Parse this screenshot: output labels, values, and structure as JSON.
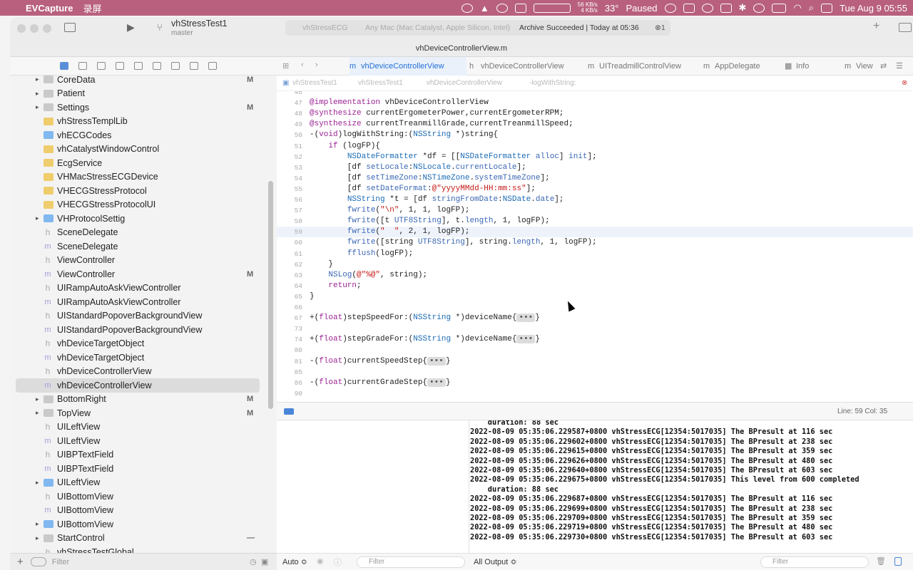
{
  "menubar": {
    "app": "EVCapture",
    "menu": "录屏",
    "net_up": "56 KB/s",
    "net_down": "4 KB/s",
    "temperature": "33°",
    "status": "Paused",
    "clock": "Tue Aug 9  05:55"
  },
  "toolbar": {
    "scheme": "vhStressTest1",
    "branch": "master",
    "target": "vhStressECG",
    "destination": "Any Mac (Mac Catalyst, Apple Silicon, Intel)",
    "activity": "Archive Succeeded | Today at 05:36",
    "error_count": "1",
    "file_title": "vhDeviceControllerView.m"
  },
  "sidebar": {
    "items": [
      {
        "label": "CoreData",
        "kind": "folder",
        "status": "M",
        "tw": "▸"
      },
      {
        "label": "Patient",
        "kind": "folder",
        "status": "",
        "tw": "▸"
      },
      {
        "label": "Settings",
        "kind": "folder",
        "status": "M",
        "tw": "▸"
      },
      {
        "label": "vhStressTemplLib",
        "kind": "yfolder",
        "status": "",
        "tw": ""
      },
      {
        "label": "vhECGCodes",
        "kind": "bfolder",
        "status": "",
        "tw": ""
      },
      {
        "label": "vhCatalystWindowControl",
        "kind": "yfolder",
        "status": "",
        "tw": ""
      },
      {
        "label": "EcgService",
        "kind": "yfolder",
        "status": "",
        "tw": ""
      },
      {
        "label": "VHMacStressECGDevice",
        "kind": "yfolder",
        "status": "",
        "tw": ""
      },
      {
        "label": "VHECGStressProtocol",
        "kind": "yfolder",
        "status": "",
        "tw": ""
      },
      {
        "label": "VHECGStressProtocolUI",
        "kind": "yfolder",
        "status": "",
        "tw": ""
      },
      {
        "label": "VHProtocolSettig",
        "kind": "bfolder",
        "status": "",
        "tw": "▸"
      },
      {
        "label": "SceneDelegate",
        "kind": "h",
        "status": "",
        "tw": ""
      },
      {
        "label": "SceneDelegate",
        "kind": "m",
        "status": "",
        "tw": ""
      },
      {
        "label": "ViewController",
        "kind": "h",
        "status": "",
        "tw": ""
      },
      {
        "label": "ViewController",
        "kind": "m",
        "status": "M",
        "tw": ""
      },
      {
        "label": "UIRampAutoAskViewController",
        "kind": "h",
        "status": "",
        "tw": ""
      },
      {
        "label": "UIRampAutoAskViewController",
        "kind": "m",
        "status": "",
        "tw": ""
      },
      {
        "label": "UIStandardPopoverBackgroundView",
        "kind": "h",
        "status": "",
        "tw": ""
      },
      {
        "label": "UIStandardPopoverBackgroundView",
        "kind": "m",
        "status": "",
        "tw": ""
      },
      {
        "label": "vhDeviceTargetObject",
        "kind": "h",
        "status": "",
        "tw": ""
      },
      {
        "label": "vhDeviceTargetObject",
        "kind": "m",
        "status": "",
        "tw": ""
      },
      {
        "label": "vhDeviceControllerView",
        "kind": "h",
        "status": "",
        "tw": ""
      },
      {
        "label": "vhDeviceControllerView",
        "kind": "m",
        "status": "",
        "tw": "",
        "selected": true
      },
      {
        "label": "BottomRight",
        "kind": "folder",
        "status": "M",
        "tw": "▸"
      },
      {
        "label": "TopView",
        "kind": "folder",
        "status": "M",
        "tw": "▸"
      },
      {
        "label": "UILeftView",
        "kind": "h",
        "status": "",
        "tw": ""
      },
      {
        "label": "UILeftView",
        "kind": "m",
        "status": "",
        "tw": ""
      },
      {
        "label": "UIBPTextField",
        "kind": "h",
        "status": "",
        "tw": ""
      },
      {
        "label": "UIBPTextField",
        "kind": "m",
        "status": "",
        "tw": ""
      },
      {
        "label": "UILeftView",
        "kind": "bfolder",
        "status": "",
        "tw": "▸"
      },
      {
        "label": "UIBottomView",
        "kind": "h",
        "status": "",
        "tw": ""
      },
      {
        "label": "UIBottomView",
        "kind": "m",
        "status": "",
        "tw": ""
      },
      {
        "label": "UIBottomView",
        "kind": "bfolder",
        "status": "",
        "tw": "▸"
      },
      {
        "label": "StartControl",
        "kind": "folder",
        "status": "—",
        "tw": "▸"
      },
      {
        "label": "vhStressTestGlobal",
        "kind": "h",
        "status": "",
        "tw": ""
      }
    ],
    "filter_placeholder": "Filter"
  },
  "tabs": [
    {
      "label": "vhDeviceControllerView",
      "icon": "m",
      "active": true
    },
    {
      "label": "vhDeviceControllerView",
      "icon": "h",
      "active": false
    },
    {
      "label": "UITreadmillControlView",
      "icon": "m",
      "active": false
    },
    {
      "label": "AppDelegate",
      "icon": "m",
      "active": false
    },
    {
      "label": "Info",
      "icon": "▦",
      "active": false
    },
    {
      "label": "View",
      "icon": "m",
      "active": false
    }
  ],
  "jumpbar": [
    "vhStressTest1",
    "vhStressTest1",
    "vhDeviceControllerView",
    "-logWithString:"
  ],
  "editor": {
    "lines": [
      {
        "n": "46",
        "html": ""
      },
      {
        "n": "47",
        "html": "<span class='kw'>@implementation</span> vhDeviceControllerView"
      },
      {
        "n": "48",
        "html": "<span class='kw'>@synthesize</span> currentErgometerPower,currentErgometerRPM;"
      },
      {
        "n": "49",
        "html": "<span class='kw'>@synthesize</span> currentTreanmillGrade,currentTreanmillSpeed;"
      },
      {
        "n": "50",
        "html": "-(<span class='kw'>void</span>)logWithString:(<span class='ty'>NSString</span> *)string{"
      },
      {
        "n": "51",
        "html": "    <span class='kw'>if</span> (logFP){"
      },
      {
        "n": "52",
        "html": "        <span class='ty'>NSDateFormatter</span> *df = [[<span class='ty'>NSDateFormatter</span> <span class='md'>alloc</span>] <span class='md'>init</span>];"
      },
      {
        "n": "53",
        "html": "        [df <span class='md'>setLocale</span>:<span class='ty'>NSLocale</span>.<span class='md'>currentLocale</span>];"
      },
      {
        "n": "54",
        "html": "        [df <span class='md'>setTimeZone</span>:<span class='ty'>NSTimeZone</span>.<span class='md'>systemTimeZone</span>];"
      },
      {
        "n": "55",
        "html": "        [df <span class='md'>setDateFormat</span>:<span class='str'>@\"yyyyMMdd-HH:mm:ss\"</span>];"
      },
      {
        "n": "56",
        "html": "        <span class='ty'>NSString</span> *t = [df <span class='md'>stringFromDate</span>:<span class='ty'>NSDate</span>.<span class='md'>date</span>];"
      },
      {
        "n": "57",
        "html": "        <span class='md'>fwrite</span>(<span class='str'>\"\\n\"</span>, 1, 1, logFP);"
      },
      {
        "n": "58",
        "html": "        <span class='md'>fwrite</span>([t <span class='md'>UTF8String</span>], t.<span class='md'>length</span>, 1, logFP);"
      },
      {
        "n": "59",
        "html": "        <span class='md'>fwrite</span>(<span class='str'>\"  \"</span>, 2, 1, logFP);",
        "cur": true
      },
      {
        "n": "60",
        "html": "        <span class='md'>fwrite</span>([string <span class='md'>UTF8String</span>], string.<span class='md'>length</span>, 1, logFP);"
      },
      {
        "n": "61",
        "html": "        <span class='md'>fflush</span>(logFP);"
      },
      {
        "n": "62",
        "html": "    }"
      },
      {
        "n": "63",
        "html": "    <span class='md'>NSLog</span>(<span class='str'>@\"%@\"</span>, string);"
      },
      {
        "n": "64",
        "html": "    <span class='kw'>return</span>;"
      },
      {
        "n": "65",
        "html": "}"
      },
      {
        "n": "66",
        "html": ""
      },
      {
        "n": "67",
        "html": "+(<span class='kw'>float</span>)stepSpeedFor:(<span class='ty'>NSString</span> *)deviceName{<span class='fold'>•••</span>}"
      },
      {
        "n": "73",
        "html": ""
      },
      {
        "n": "74",
        "html": "+(<span class='kw'>float</span>)stepGradeFor:(<span class='ty'>NSString</span> *)deviceName{<span class='fold'>•••</span>}"
      },
      {
        "n": "80",
        "html": ""
      },
      {
        "n": "81",
        "html": "-(<span class='kw'>float</span>)currentSpeedStep{<span class='fold'>•••</span>}"
      },
      {
        "n": "85",
        "html": ""
      },
      {
        "n": "86",
        "html": "-(<span class='kw'>float</span>)currentGradeStep{<span class='fold'>•••</span>}"
      },
      {
        "n": "90",
        "html": ""
      }
    ],
    "cursor_pos": "Line: 59  Col: 35"
  },
  "console": {
    "lines": [
      "    duration: 88 sec",
      "2022-08-09 05:35:06.229587+0800 vhStressECG[12354:5017035] The BPresult at 116 sec",
      "2022-08-09 05:35:06.229602+0800 vhStressECG[12354:5017035] The BPresult at 238 sec",
      "2022-08-09 05:35:06.229615+0800 vhStressECG[12354:5017035] The BPresult at 359 sec",
      "2022-08-09 05:35:06.229626+0800 vhStressECG[12354:5017035] The BPresult at 480 sec",
      "2022-08-09 05:35:06.229640+0800 vhStressECG[12354:5017035] The BPresult at 603 sec",
      "2022-08-09 05:35:06.229675+0800 vhStressECG[12354:5017035] This level from 600 completed",
      "    duration: 88 sec",
      "2022-08-09 05:35:06.229687+0800 vhStressECG[12354:5017035] The BPresult at 116 sec",
      "2022-08-09 05:35:06.229699+0800 vhStressECG[12354:5017035] The BPresult at 238 sec",
      "2022-08-09 05:35:06.229709+0800 vhStressECG[12354:5017035] The BPresult at 359 sec",
      "2022-08-09 05:35:06.229719+0800 vhStressECG[12354:5017035] The BPresult at 480 sec",
      "2022-08-09 05:35:06.229730+0800 vhStressECG[12354:5017035] The BPresult at 603 sec"
    ]
  },
  "bottombar": {
    "auto_label": "Auto ≎",
    "filter_left": "Filter",
    "output_label": "All Output ≎",
    "filter_right": "Filter"
  }
}
